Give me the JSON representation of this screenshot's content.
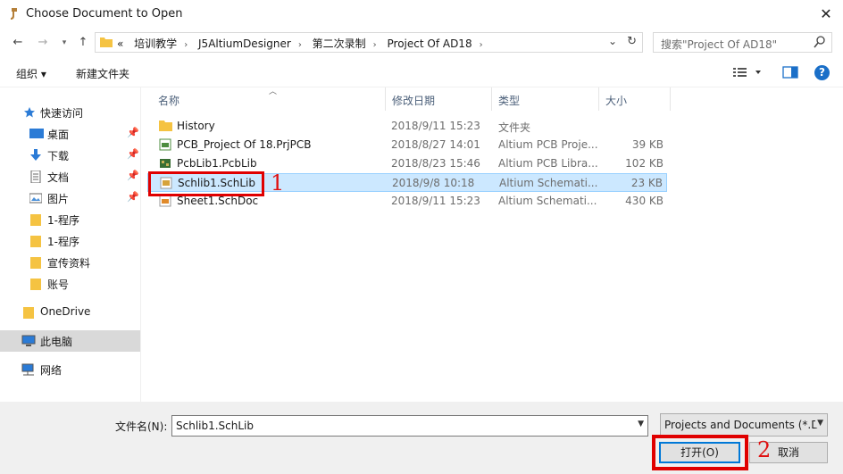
{
  "window": {
    "title": "Choose Document to Open"
  },
  "address": {
    "overflow": "«",
    "crumbs": [
      "培训教学",
      "J5AltiumDesigner",
      "第二次录制",
      "Project Of AD18"
    ]
  },
  "search": {
    "placeholder": "搜索\"Project Of AD18\""
  },
  "toolbar": {
    "organize": "组织 ▾",
    "new_folder": "新建文件夹"
  },
  "sidebar": {
    "items": [
      {
        "label": "快速访问",
        "icon": "star-icon"
      },
      {
        "label": "桌面",
        "icon": "desktop-icon",
        "pinned": true
      },
      {
        "label": "下载",
        "icon": "download-icon",
        "pinned": true
      },
      {
        "label": "文档",
        "icon": "document-icon",
        "pinned": true
      },
      {
        "label": "图片",
        "icon": "picture-icon",
        "pinned": true
      },
      {
        "label": "1-程序",
        "icon": "folder-icon"
      },
      {
        "label": "1-程序",
        "icon": "folder-icon"
      },
      {
        "label": "宣传资料",
        "icon": "folder-icon"
      },
      {
        "label": "账号",
        "icon": "folder-icon"
      },
      {
        "label": "OneDrive",
        "icon": "cloud-folder-icon"
      },
      {
        "label": "此电脑",
        "icon": "computer-icon"
      },
      {
        "label": "网络",
        "icon": "network-icon"
      }
    ]
  },
  "columns": {
    "name": "名称",
    "date": "修改日期",
    "type": "类型",
    "size": "大小"
  },
  "files": [
    {
      "name": "History",
      "date": "2018/9/11 15:23",
      "type": "文件夹",
      "size": "",
      "icon": "folder-icon"
    },
    {
      "name": "PCB_Project Of 18.PrjPCB",
      "date": "2018/8/27 14:01",
      "type": "Altium PCB Proje...",
      "size": "39 KB",
      "icon": "prjpcb-file-icon"
    },
    {
      "name": "PcbLib1.PcbLib",
      "date": "2018/8/23 15:46",
      "type": "Altium PCB Libra...",
      "size": "102 KB",
      "icon": "pcblib-file-icon"
    },
    {
      "name": "Schlib1.SchLib",
      "date": "2018/9/8 10:18",
      "type": "Altium Schemati...",
      "size": "23 KB",
      "icon": "schlib-file-icon",
      "selected": true
    },
    {
      "name": "Sheet1.SchDoc",
      "date": "2018/9/11 15:23",
      "type": "Altium Schemati...",
      "size": "430 KB",
      "icon": "schdoc-file-icon"
    }
  ],
  "annotations": {
    "one": "1",
    "two": "2",
    "color": "#e00000"
  },
  "bottom": {
    "filename_label": "文件名(N):",
    "filename_value": "Schlib1.SchLib",
    "filetype_value": "Projects and Documents (*.D",
    "open_label": "打开(O)",
    "cancel_label": "取消"
  },
  "colors": {
    "selection": "#cce8ff",
    "accent": "#0078d7",
    "folder": "#f5c342"
  }
}
